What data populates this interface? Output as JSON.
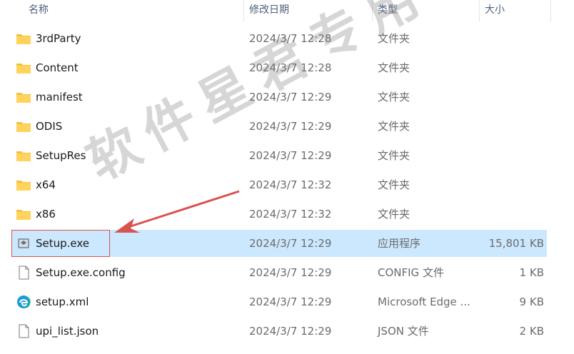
{
  "header": {
    "name": "名称",
    "date": "修改日期",
    "type": "类型",
    "size": "大小"
  },
  "files": [
    {
      "name": "3rdParty",
      "date": "2024/3/7 12:28",
      "type": "文件夹",
      "size": "",
      "icon": "folder-icon"
    },
    {
      "name": "Content",
      "date": "2024/3/7 12:28",
      "type": "文件夹",
      "size": "",
      "icon": "folder-icon"
    },
    {
      "name": "manifest",
      "date": "2024/3/7 12:29",
      "type": "文件夹",
      "size": "",
      "icon": "folder-icon"
    },
    {
      "name": "ODIS",
      "date": "2024/3/7 12:29",
      "type": "文件夹",
      "size": "",
      "icon": "folder-icon"
    },
    {
      "name": "SetupRes",
      "date": "2024/3/7 12:29",
      "type": "文件夹",
      "size": "",
      "icon": "folder-icon"
    },
    {
      "name": "x64",
      "date": "2024/3/7 12:32",
      "type": "文件夹",
      "size": "",
      "icon": "folder-icon"
    },
    {
      "name": "x86",
      "date": "2024/3/7 12:32",
      "type": "文件夹",
      "size": "",
      "icon": "folder-icon"
    },
    {
      "name": "Setup.exe",
      "date": "2024/3/7 12:29",
      "type": "应用程序",
      "size": "15,801 KB",
      "icon": "installer-icon",
      "selected": true
    },
    {
      "name": "Setup.exe.config",
      "date": "2024/3/7 12:29",
      "type": "CONFIG 文件",
      "size": "1 KB",
      "icon": "file-icon"
    },
    {
      "name": "setup.xml",
      "date": "2024/3/7 12:29",
      "type": "Microsoft Edge ...",
      "size": "9 KB",
      "icon": "edge-icon"
    },
    {
      "name": "upi_list.json",
      "date": "2024/3/7 12:29",
      "type": "JSON 文件",
      "size": "2 KB",
      "icon": "file-icon"
    }
  ],
  "watermark": "软件星君专用",
  "colors": {
    "selection": "#cce8ff",
    "folder": "#f5c042",
    "annotation": "#d9534f"
  }
}
